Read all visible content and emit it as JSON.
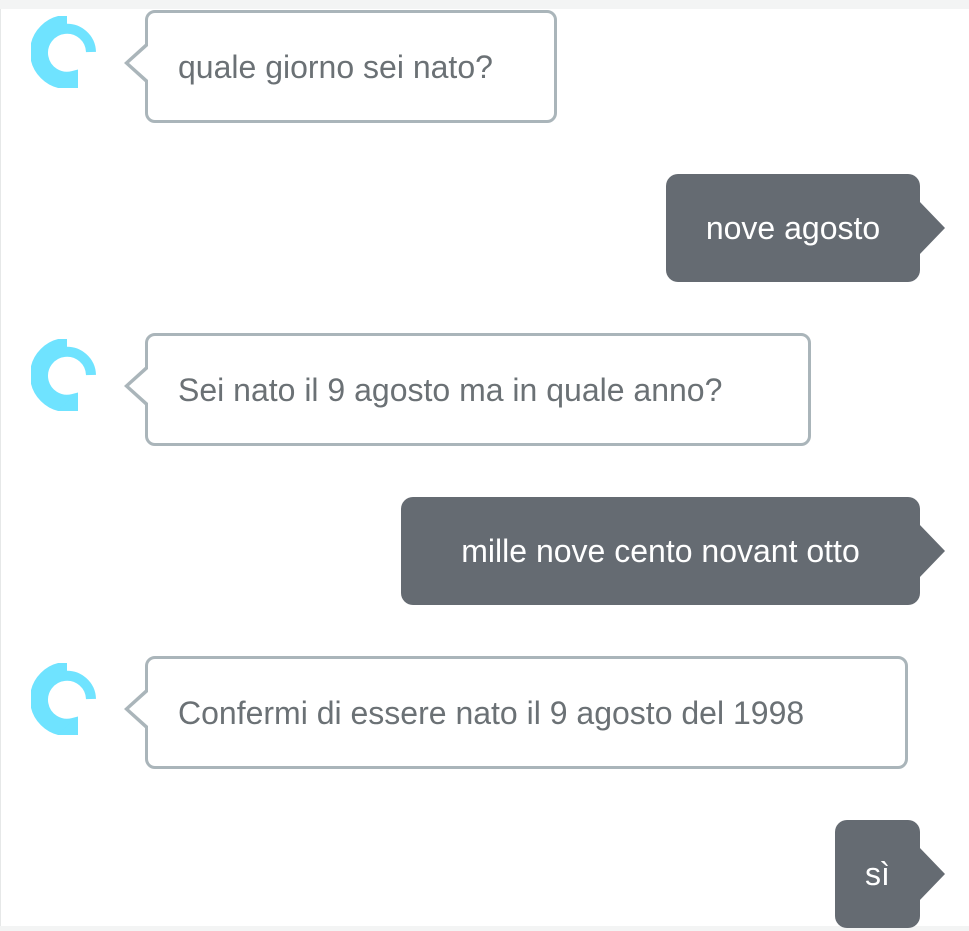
{
  "colors": {
    "alexa_bubble_border": "#aab5ba",
    "alexa_text": "#6b7175",
    "user_bubble": "#656b72",
    "user_text": "#ffffff",
    "alexa_icon": "#6fe3ff"
  },
  "conversation": {
    "messages": [
      {
        "speaker": "alexa",
        "icon": "alexa-ring-icon",
        "text": "quale giorno sei nato?"
      },
      {
        "speaker": "user",
        "text": "nove agosto"
      },
      {
        "speaker": "alexa",
        "icon": "alexa-ring-icon",
        "text": "Sei nato il 9 agosto ma in quale anno?"
      },
      {
        "speaker": "user",
        "text": "mille nove cento novant otto"
      },
      {
        "speaker": "alexa",
        "icon": "alexa-ring-icon",
        "text": "Confermi di essere nato il 9 agosto del 1998"
      },
      {
        "speaker": "user",
        "text": "sì"
      }
    ]
  }
}
